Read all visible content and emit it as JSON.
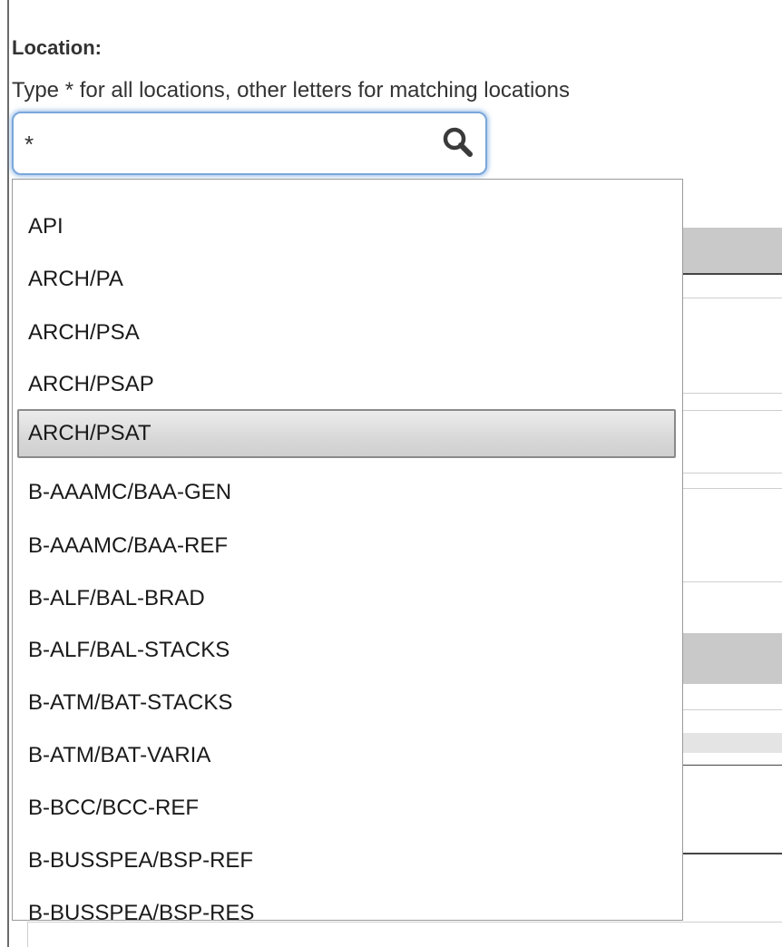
{
  "field": {
    "label": "Location:",
    "hint": "Type * for all locations, other letters for matching locations",
    "value": "*"
  },
  "icons": {
    "search": "search-icon"
  },
  "colors": {
    "input_focus_border": "#7aa7db",
    "selected_option_bg": "#d8d8d8"
  },
  "dropdown": {
    "options": [
      "API",
      "ARCH/PA",
      "ARCH/PSA",
      "ARCH/PSAP",
      "ARCH/PSAT",
      "B-AAAMC/BAA-GEN",
      "B-AAAMC/BAA-REF",
      "B-ALF/BAL-BRAD",
      "B-ALF/BAL-STACKS",
      "B-ATM/BAT-STACKS",
      "B-ATM/BAT-VARIA",
      "B-BCC/BCC-REF",
      "B-BUSSPEA/BSP-REF",
      "B-BUSSPEA/BSP-RES"
    ],
    "selected": "ARCH/PSAT"
  }
}
